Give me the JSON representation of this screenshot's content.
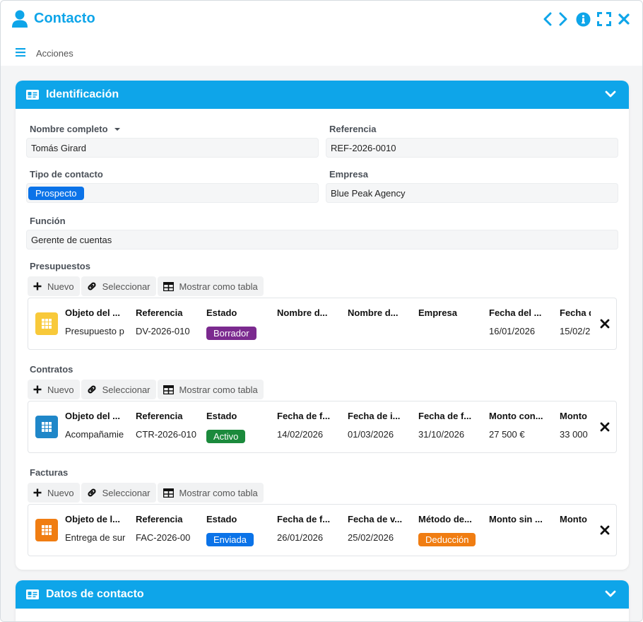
{
  "window": {
    "title": "Contacto",
    "actions_label": "Acciones"
  },
  "colors": {
    "accent": "#0ea5e9",
    "prospecto": "#0b73e8",
    "borrador": "#7b2a8f",
    "activo": "#1b8a3c",
    "enviada": "#0b73e8",
    "deduccion": "#f07d12",
    "presupuesto_icon": "#f8c93a",
    "contrato_icon": "#1f87c9",
    "factura_icon": "#f07d12"
  },
  "identificacion": {
    "title": "Identificación",
    "nombre_label": "Nombre completo",
    "nombre_value": "Tomás Girard",
    "referencia_label": "Referencia",
    "referencia_value": "REF-2026-0010",
    "tipo_label": "Tipo de contacto",
    "tipo_value": "Prospecto",
    "empresa_label": "Empresa",
    "empresa_value": "Blue Peak Agency",
    "funcion_label": "Función",
    "funcion_value": "Gerente de cuentas"
  },
  "toolbar": {
    "nuevo": "Nuevo",
    "seleccionar": "Seleccionar",
    "mostrar": "Mostrar como tabla"
  },
  "presupuestos": {
    "label": "Presupuestos",
    "headers": [
      "Objeto del ...",
      "Referencia",
      "Estado",
      "Nombre d...",
      "Nombre d...",
      "Empresa",
      "Fecha del ...",
      "Fecha d"
    ],
    "values": [
      "Presupuesto p",
      "DV-2026-010",
      "Borrador",
      "",
      "",
      "",
      "16/01/2026",
      "15/02/2"
    ]
  },
  "contratos": {
    "label": "Contratos",
    "headers": [
      "Objeto del ...",
      "Referencia",
      "Estado",
      "Fecha de f...",
      "Fecha de i...",
      "Fecha de f...",
      "Monto con...",
      "Monto"
    ],
    "values": [
      "Acompañamie",
      "CTR-2026-010",
      "Activo",
      "14/02/2026",
      "01/03/2026",
      "31/10/2026",
      "27 500 €",
      "33 000"
    ]
  },
  "facturas": {
    "label": "Facturas",
    "headers": [
      "Objeto de l...",
      "Referencia",
      "Estado",
      "Fecha de f...",
      "Fecha de v...",
      "Método de...",
      "Monto sin ...",
      "Monto"
    ],
    "values": [
      "Entrega de sur",
      "FAC-2026-00",
      "Enviada",
      "26/01/2026",
      "25/02/2026",
      "Deducción",
      "",
      ""
    ]
  },
  "datos_contacto": {
    "title": "Datos de contacto"
  }
}
